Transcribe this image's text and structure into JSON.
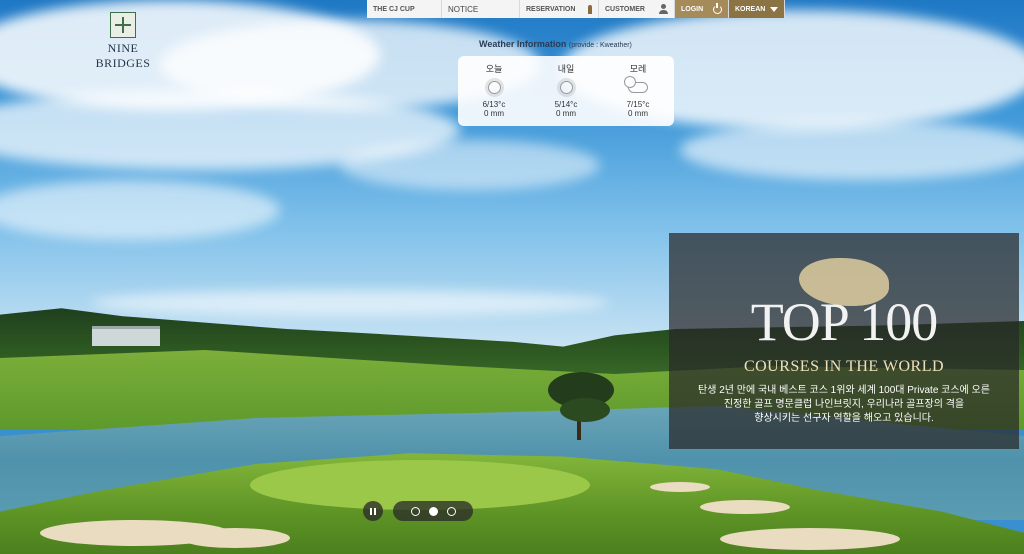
{
  "logo": {
    "text": "NINE BRIDGES"
  },
  "nav": {
    "cj_cup": "THE CJ CUP",
    "notice": "NOTICE",
    "reservation": "RESERVATION",
    "customer": "CUSTOMER",
    "login": "LOGIN",
    "language": "KOREAN"
  },
  "weather": {
    "title": "Weather Information",
    "provider": "(provide : Kweather)",
    "days": [
      {
        "name": "오늘",
        "temp": "6/13°c",
        "rain": "0 mm",
        "icon": "sun-icon"
      },
      {
        "name": "내일",
        "temp": "5/14°c",
        "rain": "0 mm",
        "icon": "sun-icon"
      },
      {
        "name": "모레",
        "temp": "7/15°c",
        "rain": "0 mm",
        "icon": "cloud-sun-icon"
      }
    ]
  },
  "promo": {
    "headline": "TOP 100",
    "subhead": "COURSES IN THE WORLD",
    "line1": "탄생 2년 만에 국내 베스트 코스 1위와 세계 100대 Private 코스에 오른",
    "line2": "진정한 골프 명문클럽 나인브릿지, 우리나라 골프장의 격을",
    "line3": "향상시키는 선구자 역할을 해오고 있습니다."
  },
  "slider": {
    "dot_count": 3,
    "active_index": 1
  }
}
